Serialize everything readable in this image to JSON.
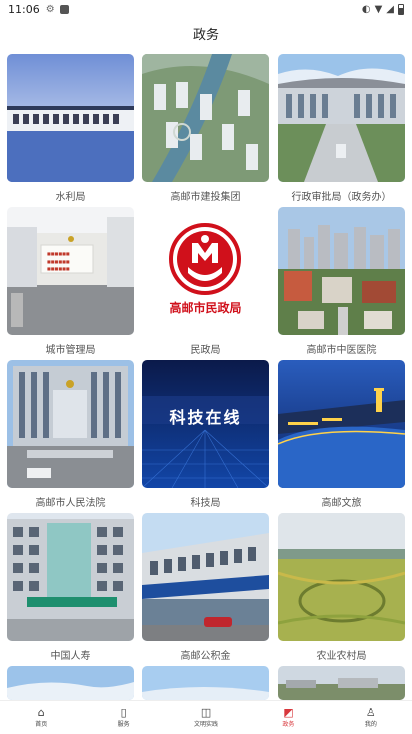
{
  "status": {
    "time": "11:06"
  },
  "header": {
    "title": "政务"
  },
  "cards": [
    {
      "label": "水利局"
    },
    {
      "label": "高邮市建投集团"
    },
    {
      "label": "行政审批局（政务办）"
    },
    {
      "label": "城市管理局"
    },
    {
      "label": "民政局",
      "logo_text": "高邮市民政局"
    },
    {
      "label": "高邮市中医医院"
    },
    {
      "label": "高邮市人民法院"
    },
    {
      "label": "科技局",
      "banner_text": "科技在线"
    },
    {
      "label": "高邮文旅"
    },
    {
      "label": "中国人寿"
    },
    {
      "label": "高邮公积金"
    },
    {
      "label": "农业农村局"
    }
  ],
  "nav": [
    {
      "label": "首页",
      "icon": "home-icon",
      "active": false
    },
    {
      "label": "服务",
      "icon": "bookmark-icon",
      "active": false
    },
    {
      "label": "文明实践",
      "icon": "bag-icon",
      "active": false
    },
    {
      "label": "政务",
      "icon": "megaphone-icon",
      "active": true
    },
    {
      "label": "我的",
      "icon": "user-icon",
      "active": false
    }
  ],
  "colors": {
    "accent": "#d8383d"
  }
}
